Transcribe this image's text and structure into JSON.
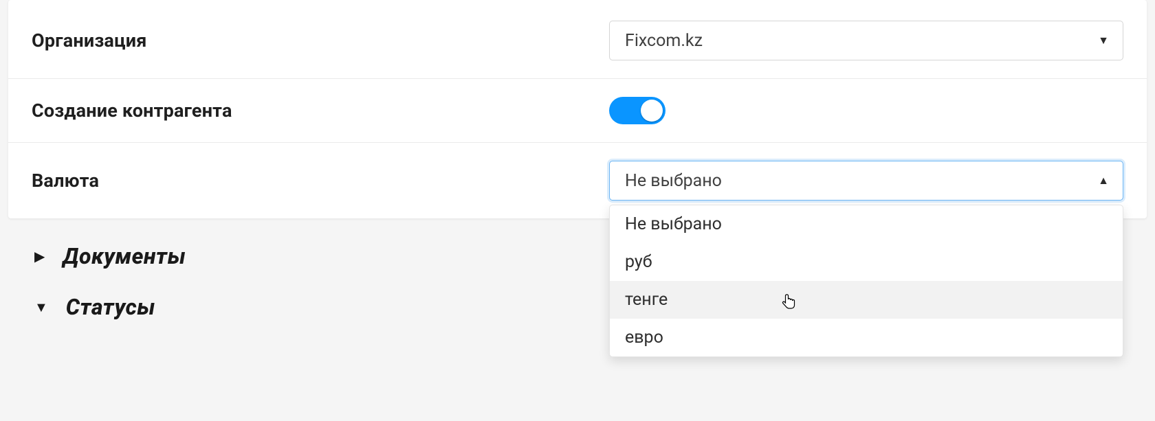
{
  "fields": {
    "organization": {
      "label": "Организация",
      "value": "Fixcom.kz"
    },
    "create_counterparty": {
      "label": "Создание контрагента",
      "on": true
    },
    "currency": {
      "label": "Валюта",
      "value": "Не выбрано",
      "options": [
        "Не выбрано",
        "руб",
        "тенге",
        "евро"
      ],
      "hover_index": 2
    }
  },
  "sections": {
    "documents": {
      "title": "Документы",
      "expanded": false
    },
    "statuses": {
      "title": "Статусы",
      "expanded": true
    }
  }
}
